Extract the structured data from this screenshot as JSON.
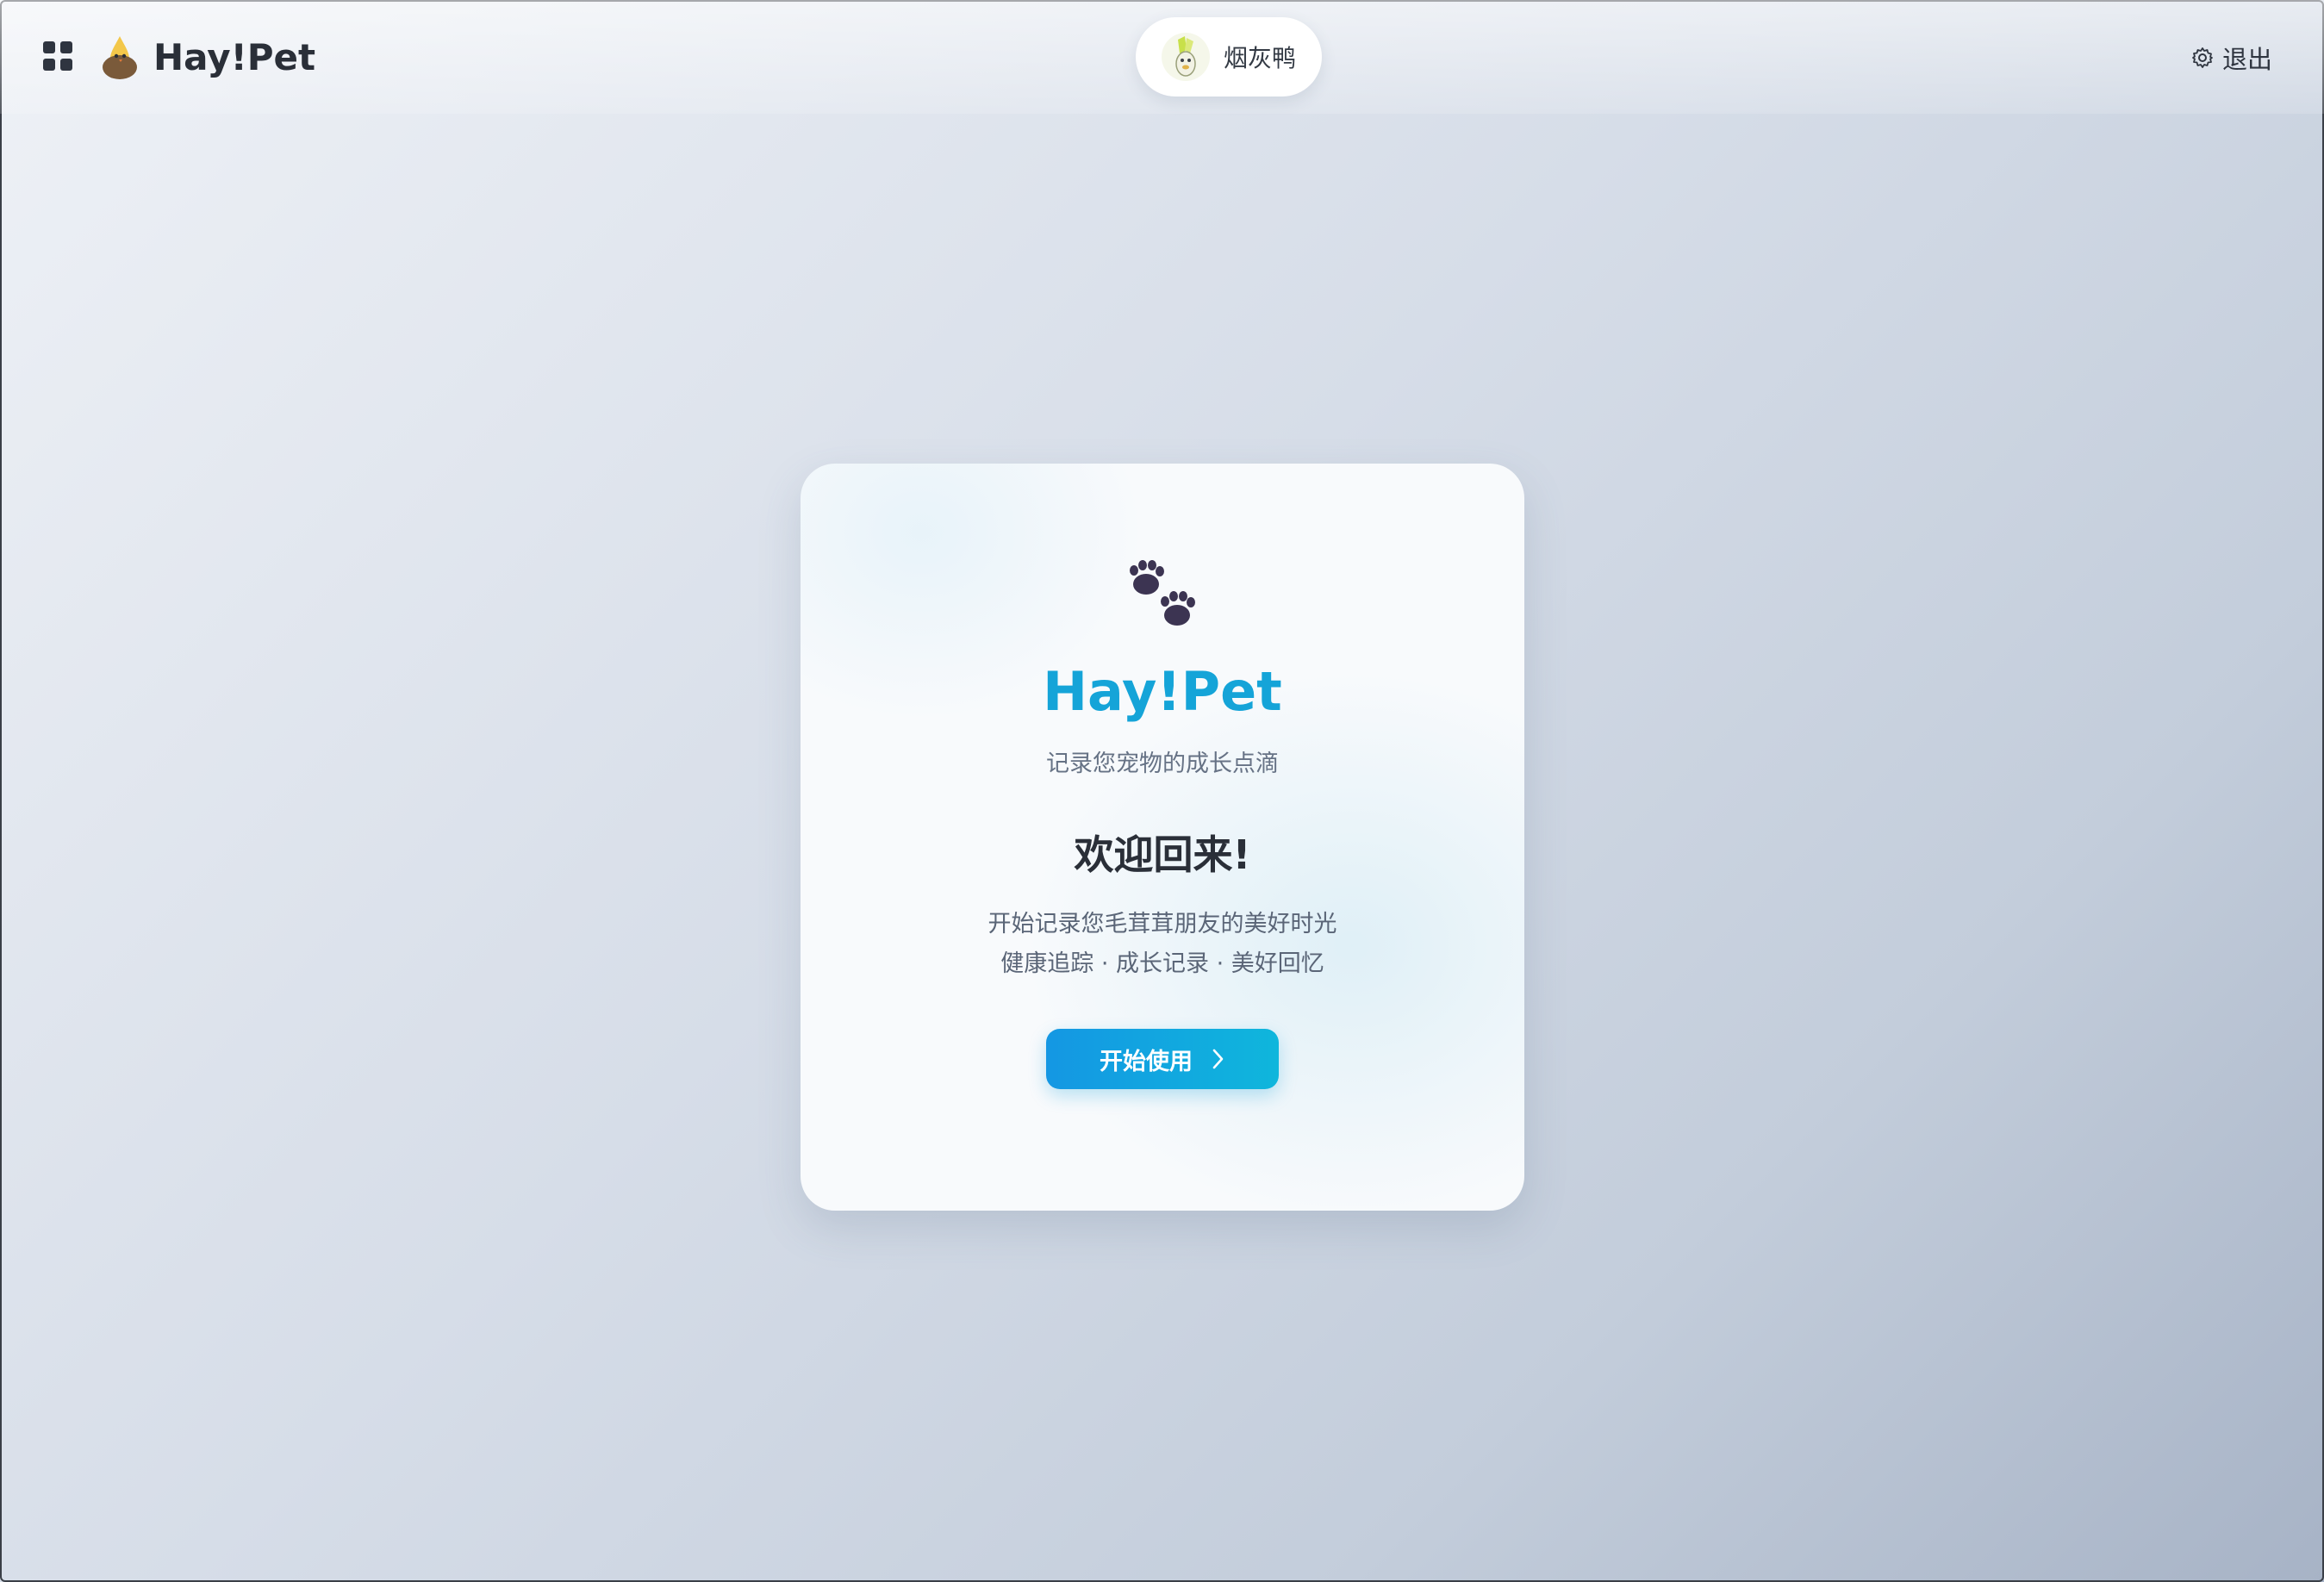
{
  "header": {
    "brand_name": "Hay!Pet",
    "pet_name": "烟灰鸭",
    "logout_label": "退出"
  },
  "card": {
    "title": "Hay!Pet",
    "subtitle": "记录您宠物的成长点滴",
    "welcome": "欢迎回来!",
    "desc_line1": "开始记录您毛茸茸朋友的美好时光",
    "desc_line2": "健康追踪 · 成长记录 · 美好回忆",
    "start_button_label": "开始使用"
  },
  "icons": {
    "apps": "apps-grid-icon",
    "brand_logo": "bird-logo-icon",
    "pet_avatar": "pet-avatar",
    "settings": "gear-icon",
    "paws": "paw-prints-icon",
    "chevron": "chevron-right-icon"
  },
  "colors": {
    "accent": "#15a4d8",
    "button_start": "#1497e3",
    "button_end": "#0fb6dc",
    "text_dark": "#2a2f38",
    "text_muted": "#5a6577"
  }
}
